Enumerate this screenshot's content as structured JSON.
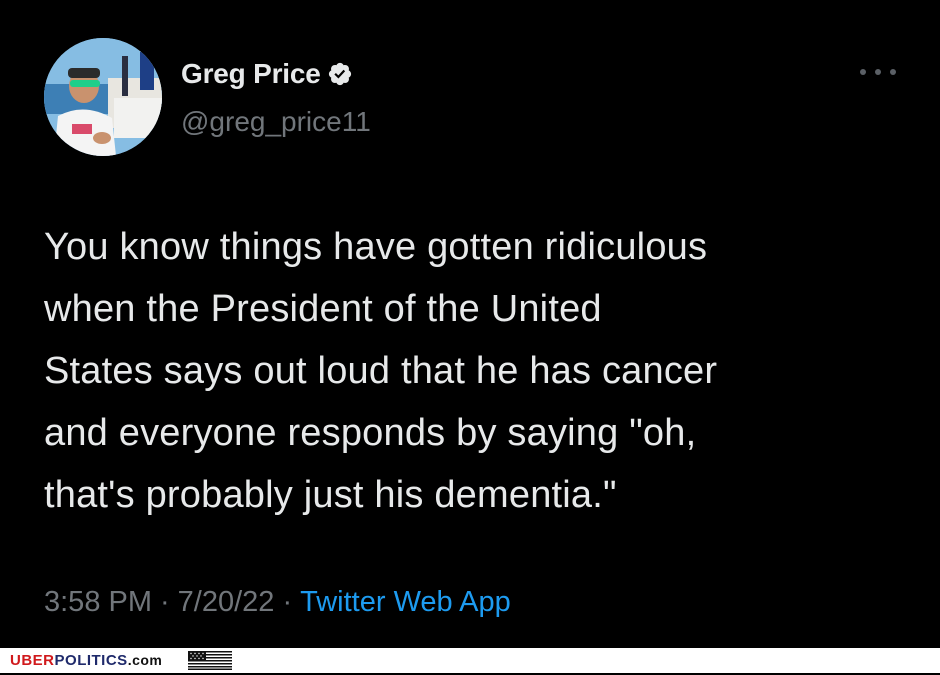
{
  "tweet": {
    "display_name": "Greg Price",
    "handle": "@greg_price11",
    "verified": true,
    "text_lines": [
      "You know things have gotten ridiculous",
      "when the President of the United",
      "States says out loud that he has cancer",
      "and everyone responds by saying \"oh,",
      "that's probably just his dementia.\""
    ],
    "time": "3:58 PM",
    "date": "7/20/22",
    "separator": "·",
    "source": "Twitter Web App"
  },
  "footer": {
    "brand_uber": "UBER",
    "brand_politics": "POLITICS",
    "brand_tld": ".com"
  },
  "colors": {
    "background": "#000000",
    "text": "#e7e9ea",
    "muted": "#71767b",
    "link": "#1d9bf0",
    "brand_red": "#d0191c",
    "brand_blue": "#1f2a6b"
  },
  "icons": {
    "verified": "verified-badge-icon",
    "more": "more-options-icon",
    "flag": "us-flag-icon"
  }
}
